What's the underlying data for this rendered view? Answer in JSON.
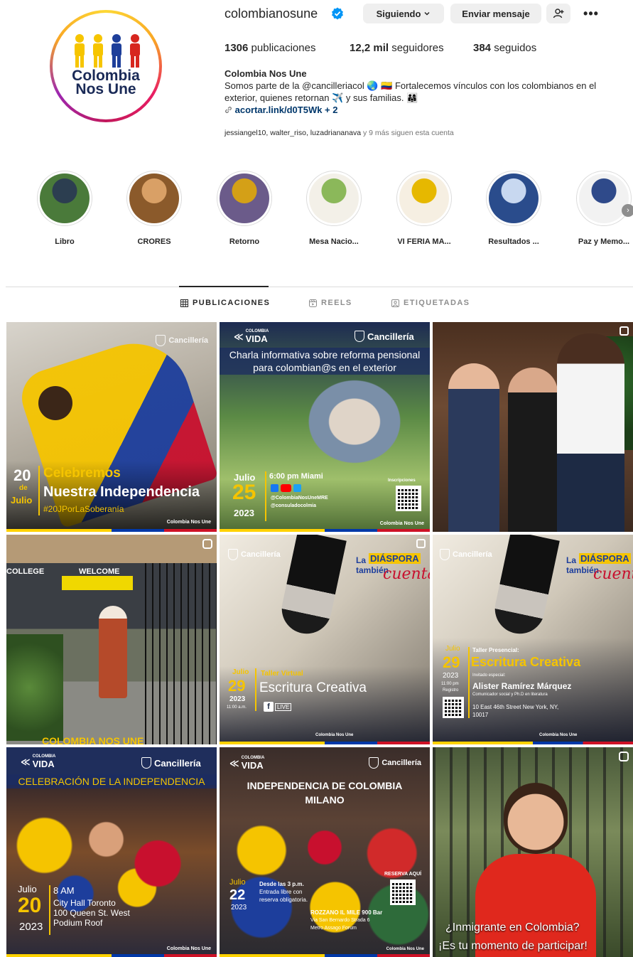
{
  "profile": {
    "username": "colombianosune",
    "avatar_text_line1": "Colombia",
    "avatar_text_line2": "Nos Une",
    "follow_label": "Siguiendo",
    "message_label": "Enviar mensaje",
    "stats": {
      "posts_value": "1306",
      "posts_label": "publicaciones",
      "followers_value": "12,2 mil",
      "followers_label": "seguidores",
      "following_value": "384",
      "following_label": "seguidos"
    },
    "bio": {
      "name": "Colombia Nos Une",
      "text_1": "Somos parte de la @cancilleriacol 🌏 🇨🇴 Fortalecemos vínculos con los colombianos en el exterior, quienes retornan ✈️ y sus familias. 👨‍👩‍👧",
      "link": "acortar.link/d0T5Wk + 2"
    },
    "followed_by": {
      "users": "jessiangel10, walter_riso, luzadriananava",
      "rest": " y 9 más siguen esta cuenta"
    }
  },
  "highlights": [
    {
      "label": "Libro",
      "color_a": "#4a7a3a",
      "color_b": "#2c3e50"
    },
    {
      "label": "CRORES",
      "color_a": "#8b5a2b",
      "color_b": "#d9a066"
    },
    {
      "label": "Retorno",
      "color_a": "#6b5b8a",
      "color_b": "#d4a017"
    },
    {
      "label": "Mesa Nacio...",
      "color_a": "#f3f0e8",
      "color_b": "#8bb85a"
    },
    {
      "label": "VI FERIA MA...",
      "color_a": "#f6efe2",
      "color_b": "#e6b800"
    },
    {
      "label": "Resultados ...",
      "color_a": "#2a4c8c",
      "color_b": "#c8d8f0"
    },
    {
      "label": "Paz y Memo...",
      "color_a": "#f2f2f2",
      "color_b": "#2f4a8a"
    }
  ],
  "tabs": {
    "posts": "PUBLICACIONES",
    "reels": "REELS",
    "tagged": "ETIQUETADAS"
  },
  "posts": {
    "p1": {
      "cancilleria": "Cancillería",
      "day": "20",
      "de": "de",
      "month": "Julio",
      "line1": "Celebremos",
      "line2": "Nuestra Independencia",
      "hashtag": "#20JPorLaSoberanía",
      "brand": "Colombia Nos Une"
    },
    "p2": {
      "vida": "VIDA",
      "vida_top": "COLOMBIA",
      "cancilleria": "Cancillería",
      "title1": "Charla informativa sobre reforma pensional",
      "title2": "para colombian@s en el exterior",
      "month": "Julio",
      "day": "25",
      "year": "2023",
      "time": "6:00 pm Miami",
      "handle1": "@ColombiaNosUneMRE",
      "handle2": "@consuladocolmia",
      "inscriptions": "Inscripciones",
      "brand": "Colombia Nos Une"
    },
    "p4": {
      "college": "COLLEGE",
      "welcome": "WELCOME",
      "banner": "COLOMBIA NOS UNE"
    },
    "p5": {
      "cancilleria": "Cancillería",
      "la": "La",
      "diaspora": "DIÁSPORA",
      "tambien": "también",
      "cuenta": "cuenta",
      "month": "Julio",
      "day": "29",
      "year": "2023",
      "time": "11:00 a.m.",
      "kind": "Taller Virtual",
      "title": "Escritura Creativa",
      "live": "LIVE",
      "brand": "Colombia Nos Une"
    },
    "p6": {
      "cancilleria": "Cancillería",
      "la": "La",
      "diaspora": "DIÁSPORA",
      "tambien": "también",
      "cuenta": "cuenta",
      "month": "Julio",
      "day": "29",
      "year": "2023",
      "time": "11:00 pm",
      "register": "Registro",
      "kind": "Taller Presencial:",
      "title": "Escritura Creativa",
      "invited": "Invitado especial:",
      "guest": "Alister Ramírez Márquez",
      "guest_role": "Comunicador social y Ph.D en literatura",
      "address1": "10 East 46th Street New York, NY,",
      "address2": "10017",
      "brand": "Colombia Nos Une"
    },
    "p7": {
      "vida": "VIDA",
      "vida_top": "COLOMBIA",
      "cancilleria": "Cancillería",
      "banner": "CELEBRACIÓN DE LA INDEPENDENCIA",
      "month": "Julio",
      "day": "20",
      "year": "2023",
      "time": "8 AM",
      "place1": "City Hall Toronto",
      "place2": "100 Queen St. West",
      "place3": "Podium Roof",
      "brand": "Colombia Nos Une"
    },
    "p8": {
      "vida": "VIDA",
      "vida_top": "COLOMBIA",
      "cancilleria": "Cancillería",
      "title1": "INDEPENDENCIA DE COLOMBIA",
      "title2": "MILANO",
      "month": "Julio",
      "day": "22",
      "year": "2023",
      "from": "Desde las 3 p.m.",
      "free1": "Entrada libre con",
      "free2": "reserva obligatoria.",
      "reserve": "RESERVA AQUÍ",
      "venue1": "ROZZANO IL MILE 900 Bar",
      "venue2": "Via San Bernardo Strada 6",
      "venue3": "Metro Assago Forum",
      "brand": "Colombia Nos Une"
    },
    "p9": {
      "line1": "¿Inmigrante en Colombia?",
      "line2": "¡Es tu momento de participar!"
    }
  }
}
